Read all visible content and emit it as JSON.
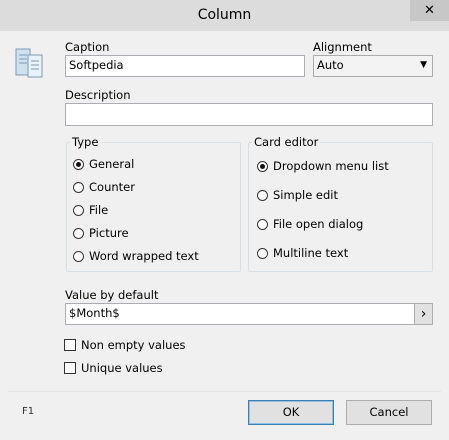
{
  "window": {
    "title": "Column",
    "close_glyph": "✕"
  },
  "caption": {
    "label": "Caption",
    "value": "Softpedia"
  },
  "alignment": {
    "label": "Alignment",
    "selected": "Auto"
  },
  "description": {
    "label": "Description",
    "value": ""
  },
  "type_group": {
    "legend": "Type",
    "options": [
      "General",
      "Counter",
      "File",
      "Picture",
      "Word wrapped text"
    ],
    "selected": "General"
  },
  "card_group": {
    "legend": "Card editor",
    "options": [
      "Dropdown menu list",
      "Simple edit",
      "File open dialog",
      "Multiline text"
    ],
    "selected": "Dropdown menu list"
  },
  "default_value": {
    "label": "Value by default",
    "value": "$Month$",
    "button_glyph": "›"
  },
  "checkboxes": {
    "non_empty": "Non empty values",
    "unique": "Unique values"
  },
  "footer": {
    "hint": "F1",
    "ok": "OK",
    "cancel": "Cancel"
  },
  "icons": {
    "columns": "columns-icon"
  },
  "colors": {
    "default_button_border": "#3c7fb1"
  }
}
